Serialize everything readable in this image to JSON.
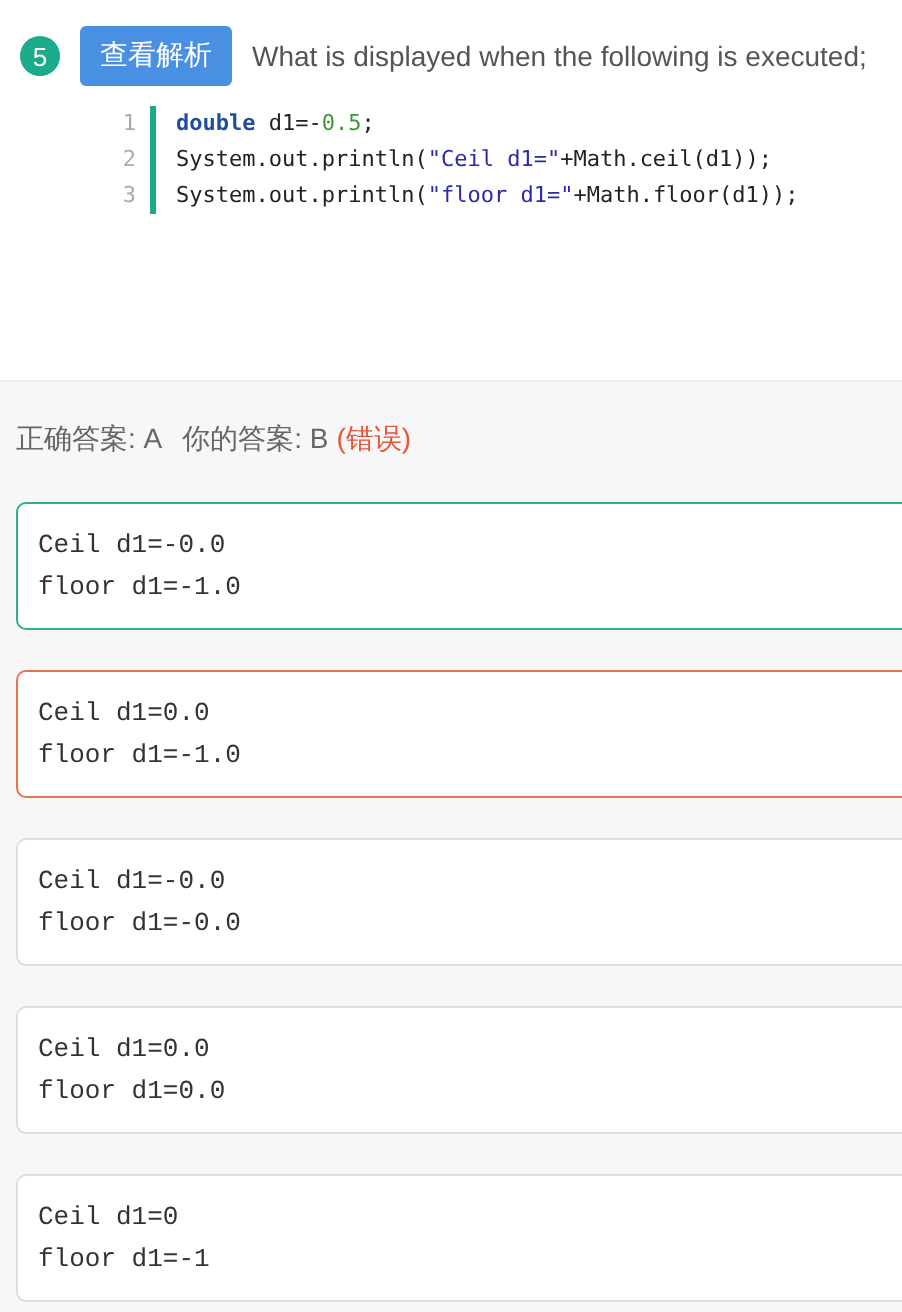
{
  "question": {
    "number": "5",
    "analysis_button": "查看解析",
    "text": "What is displayed when the following is executed;",
    "code": [
      {
        "line": "1",
        "tokens": [
          {
            "kind": "keyword",
            "text": "double"
          },
          {
            "kind": "plain",
            "text": " d1=-"
          },
          {
            "kind": "number",
            "text": "0.5"
          },
          {
            "kind": "plain",
            "text": ";"
          }
        ]
      },
      {
        "line": "2",
        "tokens": [
          {
            "kind": "plain",
            "text": "System.out.println("
          },
          {
            "kind": "string",
            "text": "\"Ceil d1=\""
          },
          {
            "kind": "plain",
            "text": "+Math.ceil(d1));"
          }
        ]
      },
      {
        "line": "3",
        "tokens": [
          {
            "kind": "plain",
            "text": "System.out.println("
          },
          {
            "kind": "string",
            "text": "\"floor d1=\""
          },
          {
            "kind": "plain",
            "text": "+Math.floor(d1));"
          }
        ]
      }
    ]
  },
  "result": {
    "correct_label": "正确答案: A",
    "your_label": "你的答案: B",
    "verdict": "(错误)"
  },
  "options": [
    {
      "lines": [
        "Ceil d1=-0.0",
        "floor d1=-1.0"
      ],
      "correct": true,
      "selected": false
    },
    {
      "lines": [
        "Ceil d1=0.0",
        "floor d1=-1.0"
      ],
      "correct": false,
      "selected": true
    },
    {
      "lines": [
        "Ceil d1=-0.0",
        "floor d1=-0.0"
      ],
      "correct": false,
      "selected": false
    },
    {
      "lines": [
        "Ceil d1=0.0",
        "floor d1=0.0"
      ],
      "correct": false,
      "selected": false
    },
    {
      "lines": [
        "Ceil d1=0",
        "floor d1=-1"
      ],
      "correct": false,
      "selected": false
    }
  ]
}
